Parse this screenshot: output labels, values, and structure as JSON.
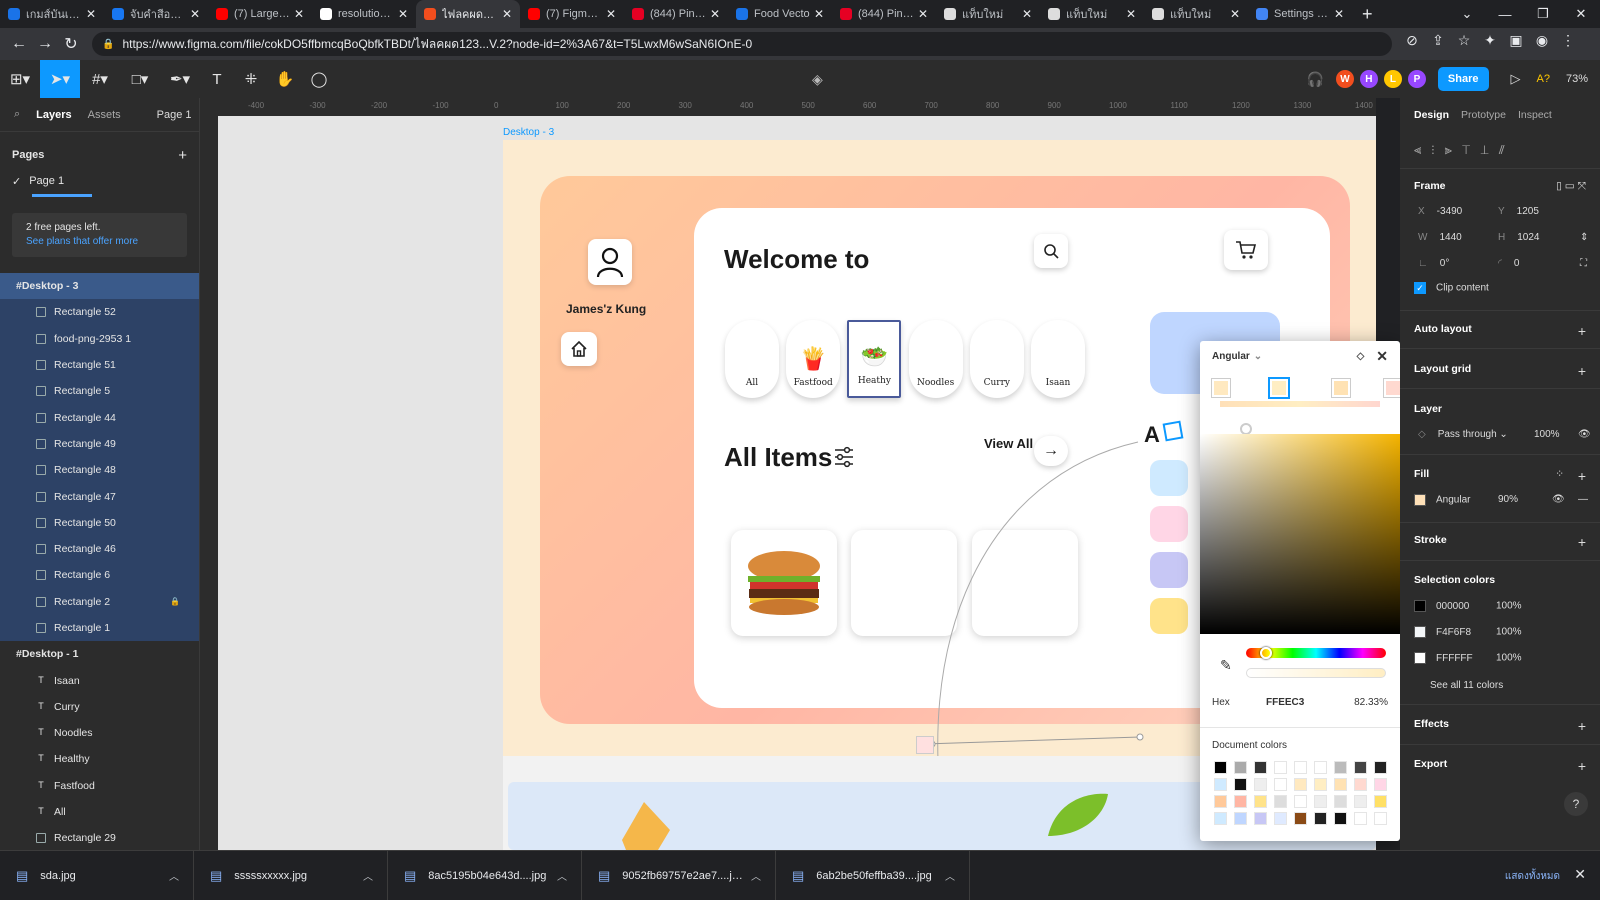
{
  "browser": {
    "tabs": [
      {
        "title": "เกมส์บันเทิง S",
        "color": "#1a73e8"
      },
      {
        "title": "จับคำสีอาร์ค",
        "color": "#1877f2"
      },
      {
        "title": "(7) Large Ne",
        "color": "#ff0000"
      },
      {
        "title": "resolution b",
        "color": "#ffffff"
      },
      {
        "title": "ไฟลคผด123...",
        "color": "#f24e1e",
        "active": true
      },
      {
        "title": "(7) Figma W",
        "color": "#ff0000"
      },
      {
        "title": "(844) Pinter",
        "color": "#e60023"
      },
      {
        "title": "Food Vecto",
        "color": "#1a73e8"
      },
      {
        "title": "(844) Pinter",
        "color": "#e60023"
      },
      {
        "title": "แท็บใหม่",
        "color": "#dddddd"
      },
      {
        "title": "แท็บใหม่",
        "color": "#dddddd"
      },
      {
        "title": "แท็บใหม่",
        "color": "#dddddd"
      },
      {
        "title": "Settings - C",
        "color": "#4285f4"
      }
    ],
    "url": "https://www.figma.com/file/cokDO5ffbmcqBoQbfkTBDt/ไฟลคผด123...V.2?node-id=2%3A67&t=T5LwxM6wSaN6IOnE-0"
  },
  "toolbar": {
    "share_label": "Share",
    "avatars": [
      {
        "letter": "W",
        "color": "#f24e1e"
      },
      {
        "letter": "H",
        "color": "#9747ff"
      },
      {
        "letter": "L",
        "color": "#ffc700"
      },
      {
        "letter": "P",
        "color": "#9747ff"
      }
    ],
    "zoom": "73%"
  },
  "left_panel": {
    "tab_layers": "Layers",
    "tab_assets": "Assets",
    "page_selector": "Page 1",
    "pages_title": "Pages",
    "current_page": "Page 1",
    "notice_line1": "2 free pages left.",
    "notice_link": "See plans that offer more",
    "frames": [
      {
        "name": "Desktop - 3",
        "selected": true,
        "children": [
          "Rectangle 52",
          "food-png-2953 1",
          "Rectangle 51",
          "Rectangle 5",
          "Rectangle 44",
          "Rectangle 49",
          "Rectangle 48",
          "Rectangle 47",
          "Rectangle 50",
          "Rectangle 46",
          "Rectangle 6",
          "Rectangle 2",
          "Rectangle 1"
        ]
      },
      {
        "name": "Desktop - 1",
        "selected": false,
        "children": [
          "Isaan",
          "Curry",
          "Noodles",
          "Healthy",
          "Fastfood",
          "All",
          "Rectangle 29"
        ]
      }
    ]
  },
  "ruler": {
    "ticks": [
      "-400",
      "-300",
      "-200",
      "-100",
      "0",
      "100",
      "200",
      "300",
      "400",
      "500",
      "600",
      "700",
      "800",
      "900",
      "1000",
      "1100",
      "1200",
      "1300",
      "1400"
    ]
  },
  "canvas": {
    "frame_label": "Desktop - 3",
    "username": "James'z Kung",
    "welcome": "Welcome to",
    "categories": [
      "All",
      "Fastfood",
      "Heathy",
      "Noodles",
      "Curry",
      "Isaan"
    ],
    "all_items": "All Items",
    "view_all": "View All",
    "partial_text": "A"
  },
  "picker": {
    "fill_type": "Angular",
    "hex_label": "Hex",
    "hex_value": "FFEEC3",
    "opacity": "82.33%",
    "document_colors": "Document colors",
    "stop_colors": [
      "#ffe9c0",
      "#ffeec3",
      "#ffe2b3",
      "#ffd9d0"
    ],
    "grid_colors": [
      "#000000",
      "#aaaaaa",
      "#333333",
      "#ffffff",
      "#ffffff",
      "#ffffff",
      "#bbbbbb",
      "#444444",
      "#222222",
      "#cfeaff",
      "#111111",
      "#eeeeee",
      "#ffffff",
      "#ffe9c0",
      "#ffeec3",
      "#ffe2b3",
      "#ffd9d0",
      "#ffd6e6",
      "#ffc99a",
      "#ffb6a4",
      "#ffe38a",
      "#dddddd",
      "#ffffff",
      "#eeeeee",
      "#dddddd",
      "#eeeeee",
      "#ffe066",
      "#cfeaff",
      "#bfd6ff",
      "#c7c7f5",
      "#dfeaff",
      "#8a4a16",
      "#222222",
      "#111111",
      "#ffffff",
      "#ffffff"
    ]
  },
  "right_panel": {
    "tab_design": "Design",
    "tab_prototype": "Prototype",
    "tab_inspect": "Inspect",
    "frame_title": "Frame",
    "x": "-3490",
    "y": "1205",
    "w": "1440",
    "h": "1024",
    "rotation": "0°",
    "radius": "0",
    "clip_content": "Clip content",
    "auto_layout": "Auto layout",
    "layout_grid": "Layout grid",
    "layer_title": "Layer",
    "blend": "Pass through",
    "layer_opacity": "100%",
    "fill_title": "Fill",
    "fill_name": "Angular",
    "fill_opacity": "90%",
    "stroke_title": "Stroke",
    "selection_colors_title": "Selection colors",
    "selection_colors": [
      {
        "hex": "000000",
        "opacity": "100%",
        "color": "#000000"
      },
      {
        "hex": "F4F6F8",
        "opacity": "100%",
        "color": "#f4f6f8"
      },
      {
        "hex": "FFFFFF",
        "opacity": "100%",
        "color": "#ffffff"
      }
    ],
    "see_all_colors": "See all 11 colors",
    "effects_title": "Effects",
    "export_title": "Export"
  },
  "downloads": {
    "items": [
      "sda.jpg",
      "sssssxxxxx.jpg",
      "8ac5195b04e643d....jpg",
      "9052fb69757e2ae7....jpg",
      "6ab2be50feffba39....jpg"
    ],
    "show_all": "แสดงทั้งหมด"
  }
}
